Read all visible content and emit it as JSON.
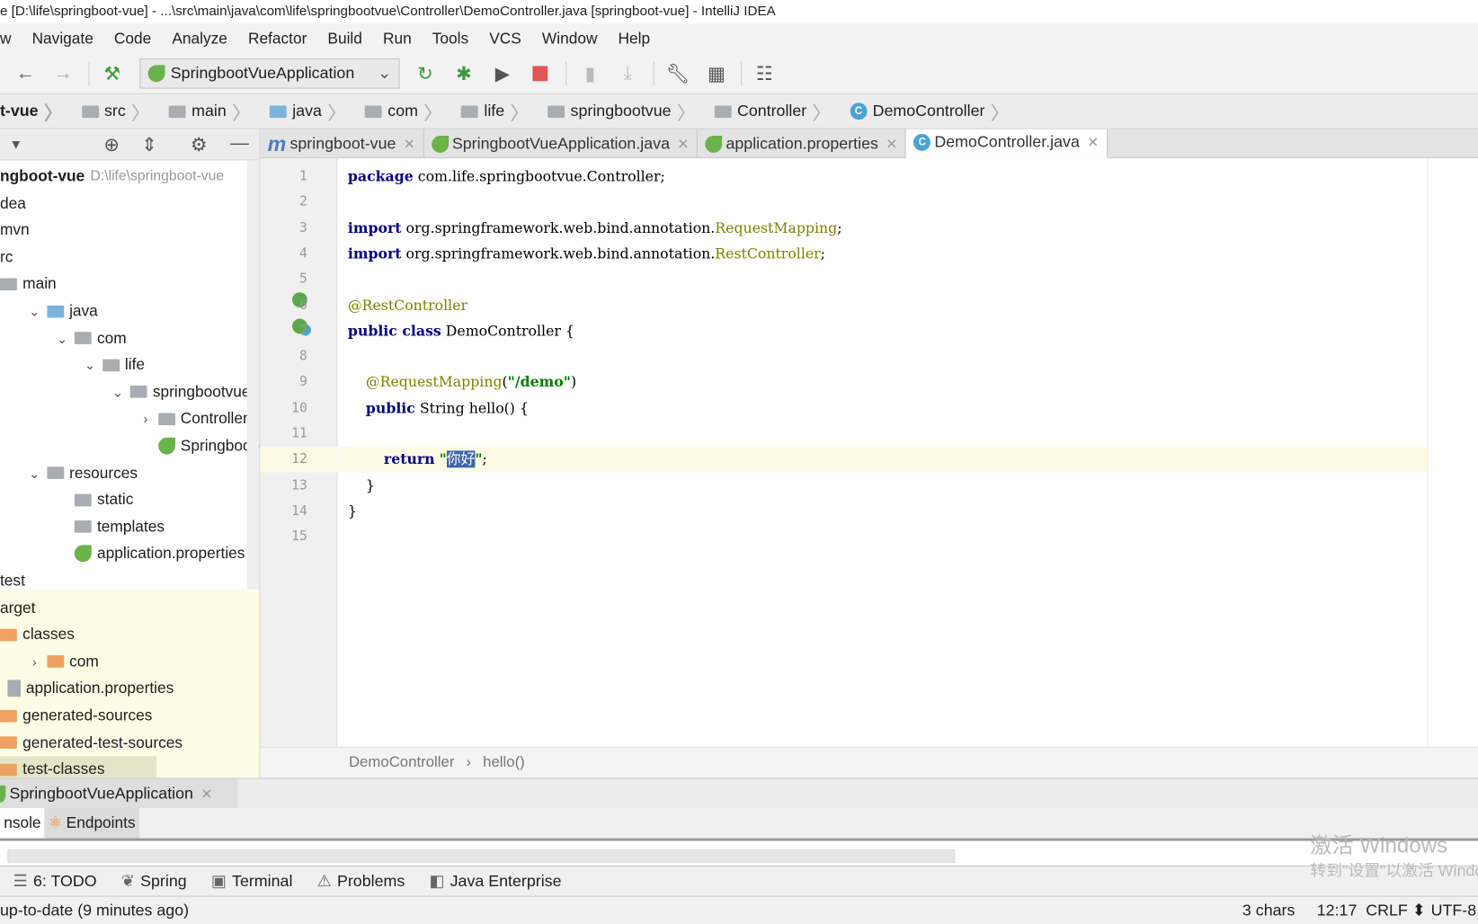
{
  "window": {
    "title": "e [D:\\life\\springboot-vue] - ...\\src\\main\\java\\com\\life\\springbootvue\\Controller\\DemoController.java [springboot-vue] - IntelliJ IDEA"
  },
  "menu": [
    "w",
    "Navigate",
    "Code",
    "Analyze",
    "Refactor",
    "Build",
    "Run",
    "Tools",
    "VCS",
    "Window",
    "Help"
  ],
  "toolbar": {
    "run_config": "SpringbootVueApplication",
    "icons": [
      "back-icon",
      "forward-icon",
      "build-hammer-icon",
      "rerun-icon",
      "debug-icon",
      "run-coverage-icon",
      "stop-icon",
      "deploy-icon",
      "download-icon",
      "wrench-icon",
      "project-structure-icon",
      "tasks-icon"
    ],
    "stop_color": "#e05555",
    "run_color": "#3c9a3c"
  },
  "navbar": [
    "t-vue",
    "src",
    "main",
    "java",
    "com",
    "life",
    "springbootvue",
    "Controller",
    "DemoController"
  ],
  "project_tree": [
    {
      "label": "ngboot-vue",
      "hint": "D:\\life\\springboot-vue",
      "depth": 0,
      "icon": "",
      "bold": true
    },
    {
      "label": "dea",
      "depth": 0,
      "icon": ""
    },
    {
      "label": "mvn",
      "depth": 0,
      "icon": ""
    },
    {
      "label": "rc",
      "depth": 0,
      "icon": ""
    },
    {
      "label": "main",
      "depth": 0,
      "icon": "folder"
    },
    {
      "label": "java",
      "depth": 1,
      "icon": "folder-blue",
      "arrow": "down"
    },
    {
      "label": "com",
      "depth": 2,
      "icon": "folder",
      "arrow": "down"
    },
    {
      "label": "life",
      "depth": 3,
      "icon": "folder",
      "arrow": "down"
    },
    {
      "label": "springbootvue",
      "depth": 4,
      "icon": "folder",
      "arrow": "down"
    },
    {
      "label": "Controller",
      "depth": 5,
      "icon": "folder",
      "arrow": "right"
    },
    {
      "label": "SpringbootVu",
      "depth": 5,
      "icon": "spring-class",
      "arrow": "none"
    },
    {
      "label": "resources",
      "depth": 1,
      "icon": "folder-resources",
      "arrow": "down"
    },
    {
      "label": "static",
      "depth": 2,
      "icon": "folder",
      "arrow": "none"
    },
    {
      "label": "templates",
      "depth": 2,
      "icon": "folder",
      "arrow": "none"
    },
    {
      "label": "application.properties",
      "depth": 2,
      "icon": "spring",
      "arrow": "none"
    },
    {
      "label": "test",
      "depth": 0,
      "icon": ""
    },
    {
      "label": "arget",
      "depth": -1,
      "icon": ""
    },
    {
      "label": "classes",
      "depth": 0,
      "icon": "folder-orange"
    },
    {
      "label": "com",
      "depth": 1,
      "icon": "folder-orange",
      "arrow": "right"
    },
    {
      "label": "application.properties",
      "depth": 1,
      "icon": "properties"
    },
    {
      "label": "generated-sources",
      "depth": 0,
      "icon": "folder-orange"
    },
    {
      "label": "generated-test-sources",
      "depth": 0,
      "icon": "folder-orange"
    },
    {
      "label": "test-classes",
      "depth": 0,
      "icon": "folder-orange",
      "selected": true
    }
  ],
  "editor_tabs": [
    {
      "label": "springboot-vue",
      "icon": "maven",
      "active": false
    },
    {
      "label": "SpringbootVueApplication.java",
      "icon": "spring-class",
      "active": false
    },
    {
      "label": "application.properties",
      "icon": "spring",
      "active": false
    },
    {
      "label": "DemoController.java",
      "icon": "class",
      "active": true
    }
  ],
  "code": [
    [
      [
        "package",
        "k"
      ],
      [
        " com.life.springbootvue.Controller;",
        ""
      ]
    ],
    [],
    [
      [
        "import",
        "k"
      ],
      [
        " org.springframework.web.bind.annotation.",
        ""
      ],
      [
        "RequestMapping",
        "c"
      ],
      [
        ";",
        ""
      ]
    ],
    [
      [
        "import",
        "k"
      ],
      [
        " org.springframework.web.bind.annotation.",
        ""
      ],
      [
        "RestController",
        "c"
      ],
      [
        ";",
        ""
      ]
    ],
    [],
    [
      [
        "@RestController",
        "a"
      ]
    ],
    [
      [
        "public class",
        "k"
      ],
      [
        " DemoController {",
        ""
      ]
    ],
    [],
    [
      [
        "    ",
        ""
      ],
      [
        "@RequestMapping",
        "a"
      ],
      [
        "(",
        ""
      ],
      [
        "\"/demo\"",
        "s"
      ],
      [
        ")",
        ""
      ]
    ],
    [
      [
        "    ",
        ""
      ],
      [
        "public",
        "k"
      ],
      [
        " String hello() {",
        ""
      ]
    ],
    [],
    [
      [
        "        ",
        ""
      ],
      [
        "return",
        "k"
      ],
      [
        " ",
        ""
      ],
      [
        "\"",
        "s"
      ],
      [
        "你好",
        "sel"
      ],
      [
        "\"",
        "s"
      ],
      [
        ";",
        ""
      ]
    ],
    [
      [
        "    }",
        ""
      ]
    ],
    [
      [
        "}",
        ""
      ]
    ],
    []
  ],
  "current_line": 12,
  "editor_breadcrumb": [
    "DemoController",
    "hello()"
  ],
  "run_tab": {
    "label": "SpringbootVueApplication"
  },
  "run_subtabs": [
    "nsole",
    "Endpoints"
  ],
  "tool_windows": [
    {
      "label": "6: TODO",
      "icon": "todo-icon"
    },
    {
      "label": "Spring",
      "icon": "spring-icon"
    },
    {
      "label": "Terminal",
      "icon": "terminal-icon"
    },
    {
      "label": "Problems",
      "icon": "warning-icon"
    },
    {
      "label": "Java Enterprise",
      "icon": "java-ee-icon"
    }
  ],
  "status": {
    "message": "up-to-date (9 minutes ago)",
    "chars": "3 chars",
    "position": "12:17",
    "line_sep": "CRLF ⬍",
    "encoding": "UTF-8"
  },
  "watermark": {
    "line1": "激活 Windows",
    "line2": "转到\"设置\"以激活 Windows。"
  }
}
